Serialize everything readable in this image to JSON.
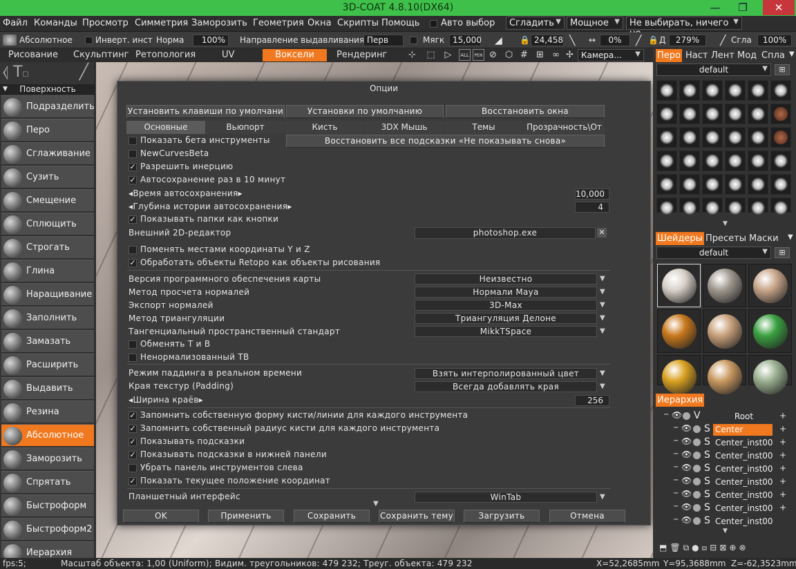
{
  "window": {
    "title": "3D-COAT 4.8.10(DX64)"
  },
  "menu": {
    "items": [
      "Файл",
      "Команды",
      "Просмотр",
      "Симметрия",
      "Заморозить",
      "Геометрия",
      "Окна",
      "Скрипты",
      "Помощь"
    ],
    "auto_select": "Авто выбор",
    "smooth": "Сгладить",
    "power": "Мощное",
    "nothing_select": "Не выбирать, ничего не"
  },
  "toolbar": {
    "mode": "Абсолютное",
    "invert": "Инверт. инст",
    "normal": "Норма",
    "normal_value": "100%",
    "direction": "Направление выдавливания",
    "direction_value": "Перв",
    "soft": "Мягк",
    "soft_value": "15,000",
    "depth_value": "24,458",
    "angle_value": "0%",
    "d_label": "Д",
    "d_value": "279%",
    "smooth_label": "Сгла",
    "smooth_value": "100%"
  },
  "room_tabs": {
    "paint": "Рисование",
    "sculpt": "Скульптинг",
    "retopo": "Ретопология",
    "uv": "UV",
    "voxels": "Воксели",
    "render": "Рендеринг",
    "camera": "Камера..."
  },
  "toolbar_icons": {
    "all": "ALL",
    "pen": "PEN"
  },
  "left_panel": {
    "header": "Поверхность",
    "tools": [
      "Подразделить",
      "Перо",
      "Сглаживание",
      "Сузить",
      "Смещение",
      "Сплющить",
      "Строгать",
      "Глина",
      "Наращивание",
      "Заполнить",
      "Замазать",
      "Расширить",
      "Выдавить",
      "Резина",
      "Абсолютное",
      "Заморозить",
      "Спрятать",
      "Быстроформ",
      "Быстроформ2",
      "Иерархия"
    ]
  },
  "dialog": {
    "title": "Опции",
    "top_buttons": [
      "Установить клавиши по умолчани",
      "Установки по умолчанию",
      "Восстановить окна"
    ],
    "tabs": [
      "Основные",
      "Вьюпорт",
      "Кисть",
      "3DX Мышь",
      "Темы",
      "Прозрачность\\От"
    ],
    "restore_hints": "Восстановить все подсказки «Не показывать снова»",
    "rows": {
      "beta": "Показать бета инструменты",
      "curves": "NewCurvesBeta",
      "inertia": "Разрешить инерцию",
      "autosave": "Автосохранение раз в 10 минут",
      "autosave_time": "Время автосохранения",
      "autosave_time_value": "10,000",
      "history_depth": "Глубина истории автосохранения",
      "history_depth_value": "4",
      "folders": "Показывать папки как кнопки",
      "editor": "Внешний 2D-редактор",
      "editor_value": "photoshop.exe",
      "swap_yz": "Поменять местами координаты Y и Z",
      "retopo_objects": "Обработать объекты Retopo как объекты рисования",
      "map_version": "Версия программного обеспечения карты",
      "map_version_value": "Неизвестно",
      "normals_method": "Метод просчета нормалей",
      "normals_method_value": "Нормали Maya",
      "normals_export": "Экспорт нормалей",
      "normals_export_value": "3D-Max",
      "triangulation": "Метод триангуляции",
      "triangulation_value": "Триангуляция Делоне",
      "tangent": "Тангенциальный пространственный стандарт",
      "tangent_value": "MikkTSpace",
      "swap_tb": "Обменять T и B",
      "unnormalized_tb": "Ненормализованный TB",
      "padding_mode": "Режим паддинга в реальном времени",
      "padding_mode_value": "Взять интерполированный цвет",
      "padding": "Края текстур (Padding)",
      "padding_value": "Всегда добавлять края",
      "edge_width": "Ширина краёв",
      "edge_width_value": "256",
      "remember_shape": "Запомнить собственную форму кисти/линии для каждого инструмента",
      "remember_radius": "Запомнить собственный радиус кисти для каждого инструмента",
      "hints": "Показывать подсказки",
      "hints_bottom": "Показывать подсказки в нижней панели",
      "hide_toolbar": "Убрать панель инструментов слева",
      "show_coords": "Показать текущее положение координат",
      "tablet": "Планшетный интерфейс",
      "tablet_value": "WinTab"
    },
    "bottom_buttons": [
      "OK",
      "Применить",
      "Сохранить",
      "Сохранить тему",
      "Загрузить",
      "Отмена"
    ]
  },
  "right_panel": {
    "brush_tabs": [
      "Перо",
      "Наст",
      "Лент",
      "Мод",
      "Спла"
    ],
    "brush_preset": "default",
    "shader_tabs": [
      "Шейдеры",
      "Пресеты",
      "Маски"
    ],
    "shader_preset": "default",
    "hierarchy_tab": "Иерархия",
    "hierarchy": {
      "root": "Root",
      "root_type": "V",
      "child_type": "S",
      "items": [
        "Center",
        "Center_inst00",
        "Center_inst00",
        "Center_inst00",
        "Center_inst00",
        "Center_inst00",
        "Center_inst00",
        "Center_inst00"
      ]
    }
  },
  "status": {
    "fps": "fps:5;",
    "info": "Масштаб объекта: 1,00 (Uniform); Видим. треугольников: 479 232; Треуг. объекта: 479 232",
    "x": "X=52,2685mm",
    "y": "Y=95,3688mm",
    "z": "Z=-62,3523mm"
  },
  "colors": {
    "accent": "#f0781e",
    "titlebar": "#3fc04a",
    "close": "#c7363a"
  }
}
